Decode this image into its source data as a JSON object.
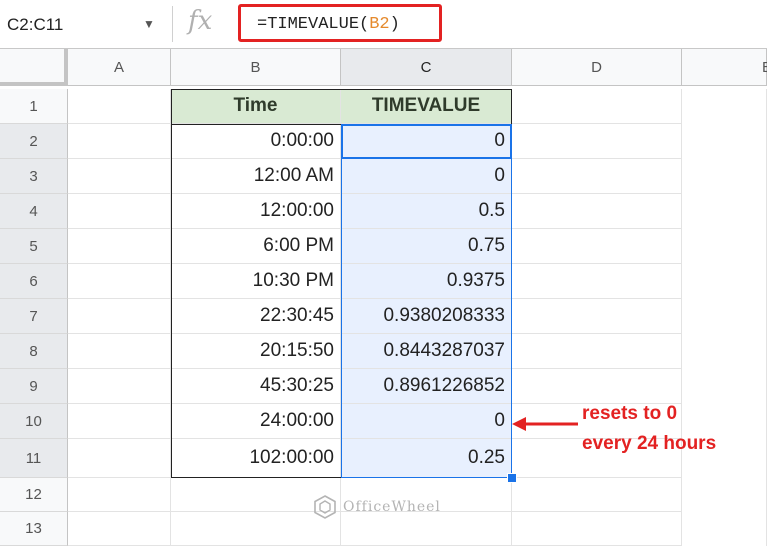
{
  "formula_bar": {
    "name_box": "C2:C11",
    "fx_label": "fx",
    "formula_prefix": "=TIMEVALUE(",
    "formula_ref": "B2",
    "formula_suffix": ")"
  },
  "columns": [
    "A",
    "B",
    "C",
    "D",
    "E"
  ],
  "rows": [
    "1",
    "2",
    "3",
    "4",
    "5",
    "6",
    "7",
    "8",
    "9",
    "10",
    "11",
    "12",
    "13"
  ],
  "table": {
    "headers": [
      "Time",
      "TIMEVALUE"
    ],
    "data": [
      [
        "0:00:00",
        "0"
      ],
      [
        "12:00 AM",
        "0"
      ],
      [
        "12:00:00",
        "0.5"
      ],
      [
        "6:00 PM",
        "0.75"
      ],
      [
        "10:30 PM",
        "0.9375"
      ],
      [
        "22:30:45",
        "0.9380208333"
      ],
      [
        "20:15:50",
        "0.8443287037"
      ],
      [
        "45:30:25",
        "0.8961226852"
      ],
      [
        "24:00:00",
        "0"
      ],
      [
        "102:00:00",
        "0.25"
      ]
    ]
  },
  "annotation": {
    "line1": "resets to 0",
    "line2": "every 24 hours"
  },
  "watermark": "OfficeWheel",
  "colors": {
    "header_fill": "#d9ead3",
    "selection_fill": "#e8f0fe",
    "selection_border": "#1a73e8",
    "annotation_red": "#e32222",
    "formula_ref": "#e58a2d"
  }
}
